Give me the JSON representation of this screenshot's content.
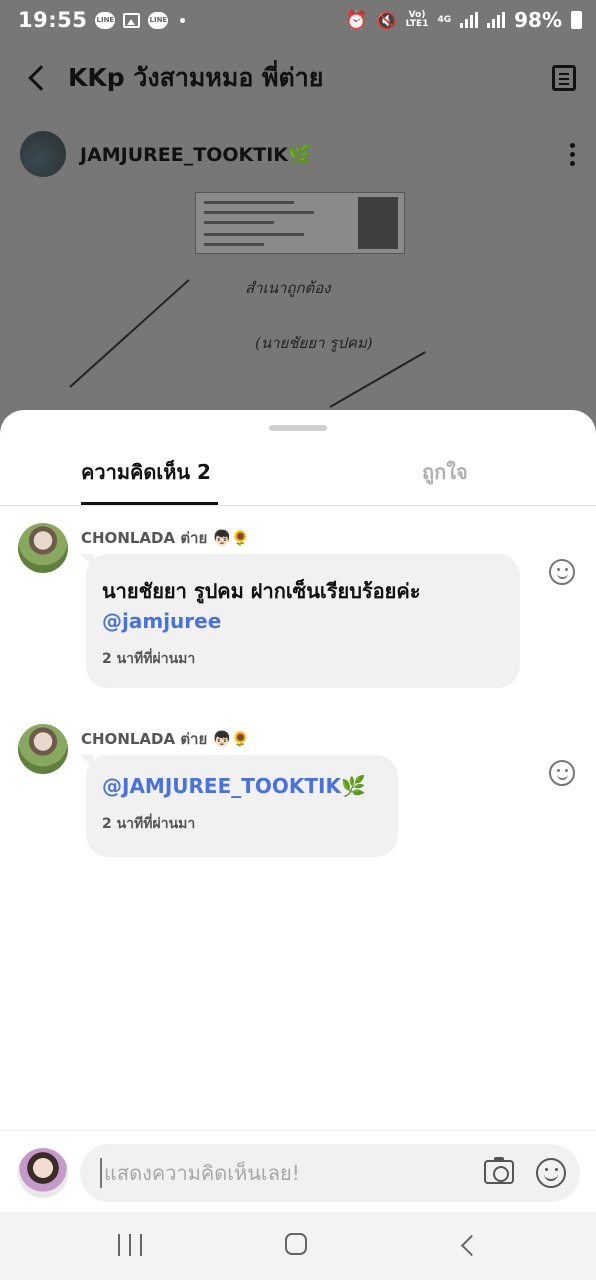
{
  "status_bar": {
    "time": "19:55",
    "notification_icons": [
      "line-icon",
      "image-icon",
      "line-icon"
    ],
    "network_label_top": "Vo)",
    "network_label_bottom": "LTE1",
    "network_type": "4G",
    "battery": "98%"
  },
  "header": {
    "title": "KKp วังสามหมอ พี่ต่าย"
  },
  "post": {
    "author_name": "JAMJUREE_TOOKTIK",
    "author_emoji": "🌿",
    "handwriting_line1": "สำเนาถูกต้อง",
    "handwriting_line2": "(นายชัยยา รูปคม)"
  },
  "tabs": {
    "comments_label": "ความคิดเห็น 2",
    "likes_label": "ถูกใจ"
  },
  "comments": [
    {
      "author": "CHONLADA ต่าย 👦🏻🌻",
      "text": "นายชัยยา รูปคม ฝากเซ็นเรียบร้อยค่ะ",
      "mention": "@jamjuree",
      "time": "2 นาทีที่ผ่านมา"
    },
    {
      "author": "CHONLADA ต่าย 👦🏻🌻",
      "text": "",
      "mention": "@JAMJUREE_TOOKTIK🌿",
      "time": "2 นาทีที่ผ่านมา"
    }
  ],
  "input": {
    "placeholder": "แสดงความคิดเห็นเลย!"
  },
  "colors": {
    "mention": "#4a72d8",
    "dim_overlay": "#777777",
    "bubble": "#f1f1f1"
  }
}
